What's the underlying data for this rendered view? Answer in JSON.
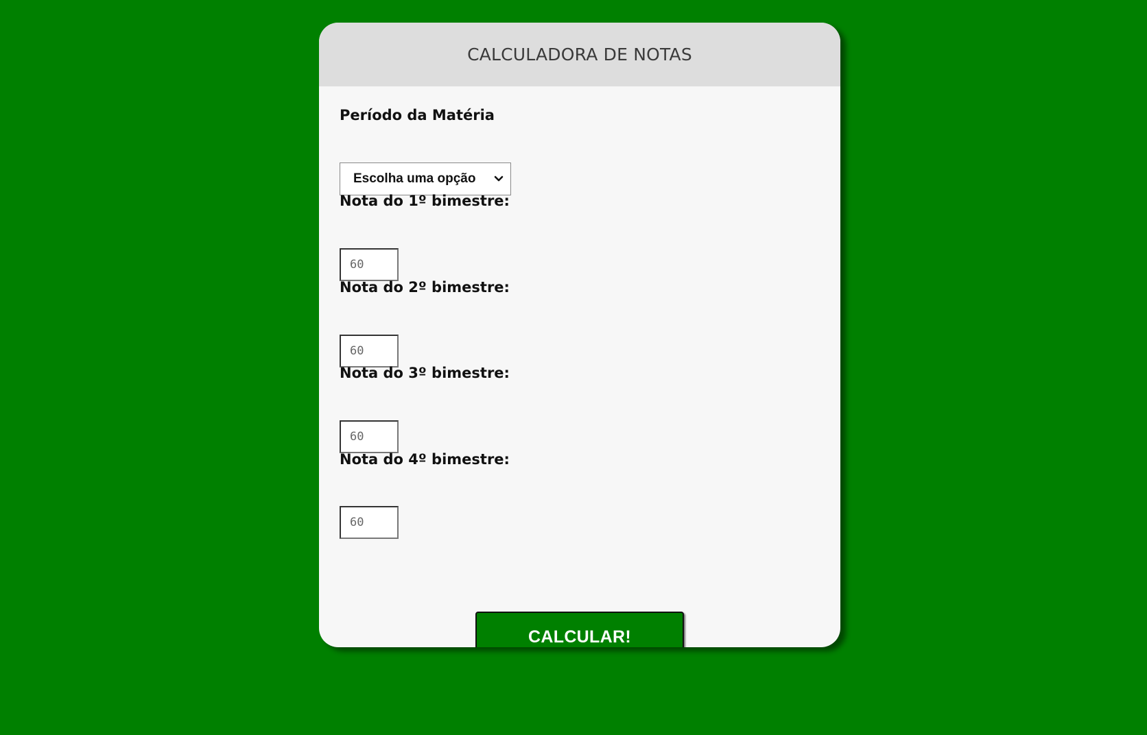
{
  "page": {
    "background_color": "#008000"
  },
  "card": {
    "title": "CALCULADORA DE NOTAS",
    "period": {
      "label": "Período da Matéria",
      "selected_option": "Escolha uma opção"
    },
    "grades": [
      {
        "label": "Nota do 1º bimestre:",
        "placeholder": "60"
      },
      {
        "label": "Nota do 2º bimestre:",
        "placeholder": "60"
      },
      {
        "label": "Nota do 3º bimestre:",
        "placeholder": "60"
      },
      {
        "label": "Nota do 4º bimestre:",
        "placeholder": "60"
      }
    ],
    "submit_label": "CALCULAR!",
    "accent_color": "#008000"
  }
}
